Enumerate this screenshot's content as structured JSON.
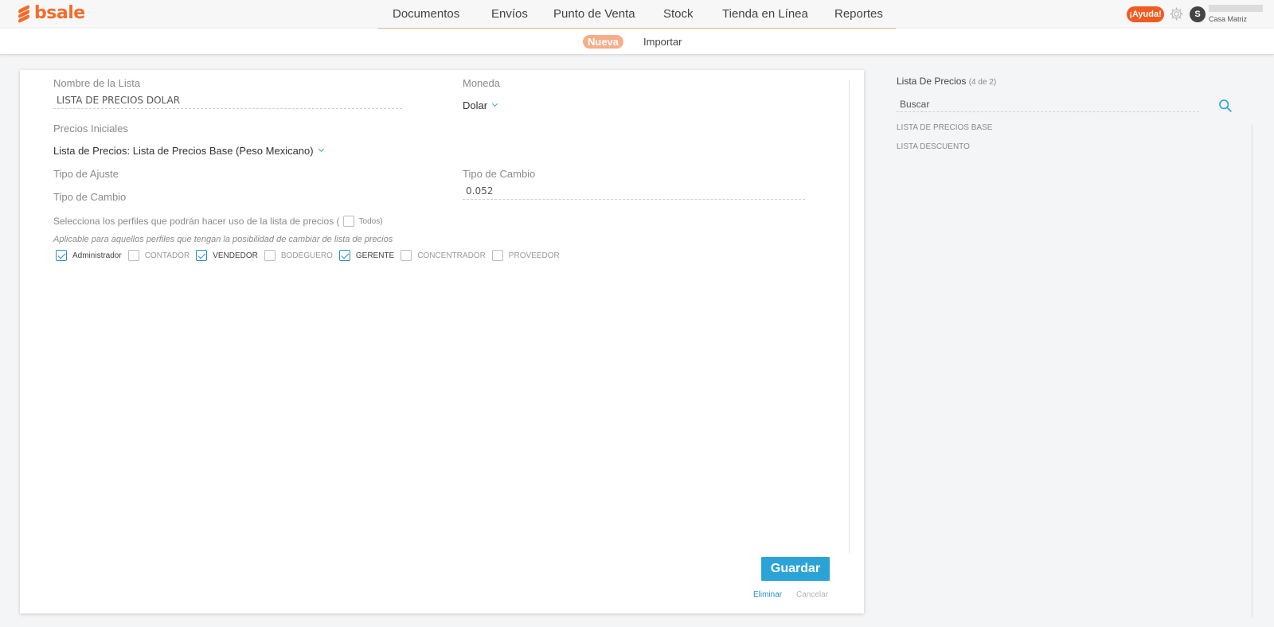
{
  "brand": {
    "name": "bsale",
    "color": "#f36c2b"
  },
  "nav": {
    "items": [
      "Documentos",
      "Envíos",
      "Punto de Venta",
      "Stock",
      "Tienda en Línea",
      "Reportes"
    ]
  },
  "header": {
    "help_label": "¡Ayuda!",
    "avatar_initial": "S",
    "branch": "Casa Matriz"
  },
  "subnav": {
    "active": "Nueva",
    "other": "Importar"
  },
  "form": {
    "name_label": "Nombre de la Lista",
    "name_value": "LISTA DE PRECIOS DOLAR",
    "currency_label": "Moneda",
    "currency_value": "Dolar",
    "initial_prices_label": "Precios Iniciales",
    "initial_prices_value": "Lista de Precios: Lista de Precios Base (Peso Mexicano)",
    "adjust_type_label": "Tipo de Ajuste",
    "exchange_type_label_right": "Tipo de Cambio",
    "exchange_type_label_left": "Tipo de Cambio",
    "exchange_value": "0.052",
    "profiles_prompt": "Selecciona los perfiles que podrán hacer uso de la lista de precios (",
    "todos_label": "Todos)",
    "profiles_note": "Aplicable para aquellos perfiles que tengan la posibilidad de cambiar de lista de precios",
    "profiles": [
      {
        "label": "Administrador",
        "checked": true
      },
      {
        "label": "CONTADOR",
        "checked": false
      },
      {
        "label": "VENDEDOR",
        "checked": true
      },
      {
        "label": "BODEGUERO",
        "checked": false
      },
      {
        "label": "GERENTE",
        "checked": true
      },
      {
        "label": "CONCENTRADOR",
        "checked": false
      },
      {
        "label": "PROVEEDOR",
        "checked": false
      }
    ],
    "save_label": "Guardar",
    "delete_label": "Eliminar",
    "cancel_label": "Cancelar"
  },
  "sidebar": {
    "title": "Lista De Precios",
    "count": "(4 de 2)",
    "search_placeholder": "Buscar",
    "items": [
      "LISTA DE PRECIOS BASE",
      "LISTA DESCUENTO"
    ]
  },
  "colors": {
    "accent": "#2ba3d7",
    "help": "#f15a22",
    "pill": "#f6ad8a"
  }
}
